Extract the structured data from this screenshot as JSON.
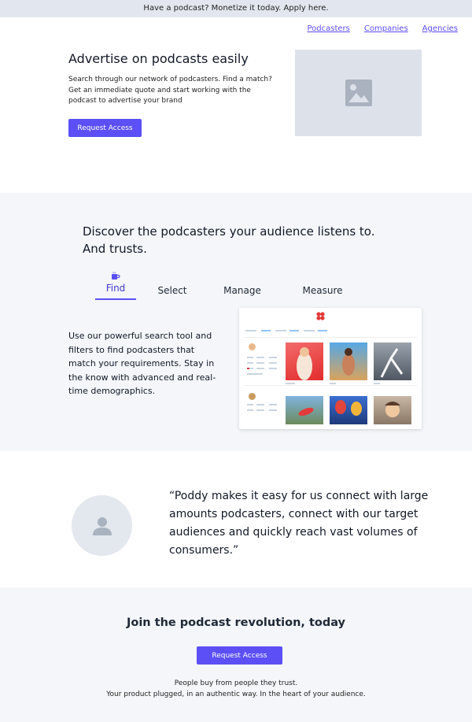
{
  "banner": {
    "text": "Have a podcast? Monetize it today. Apply here."
  },
  "nav": {
    "items": [
      "Podcasters",
      "Companies",
      "Agencies"
    ]
  },
  "hero": {
    "title": "Advertise on podcasts easily",
    "description": "Search through our network of podcasters. Find a match? Get an immediate quote and start working with the podcast to advertise your brand",
    "button_label": "Request Access",
    "image_icon": "image-placeholder-icon"
  },
  "discover": {
    "title": "Discover the podcasters your audience listens to. And trusts.",
    "tabs": [
      {
        "label": "Find",
        "icon": "coffee-cup-icon",
        "active": true
      },
      {
        "label": "Select"
      },
      {
        "label": "Manage"
      },
      {
        "label": "Measure"
      }
    ],
    "description": "Use our powerful search tool and filters to find podcasters that match your requirements. Stay in the know with advanced and real-time demographics."
  },
  "testimonial": {
    "quote": "“Poddy makes it easy for us connect with large amounts podcasters, connect with our target audiences and quickly reach vast volumes of consumers.”",
    "avatar_icon": "user-icon"
  },
  "cta": {
    "title": "Join the podcast revolution, today",
    "button_label": "Request Access",
    "line1": "People buy from people they trust.",
    "line2": "Your product plugged, in an authentic way. In the heart of your audience."
  },
  "colors": {
    "accent": "#5b4ff5",
    "banner_bg": "#e2e7ef",
    "section_bg": "#f4f6f9",
    "placeholder_bg": "#dde2ea"
  }
}
